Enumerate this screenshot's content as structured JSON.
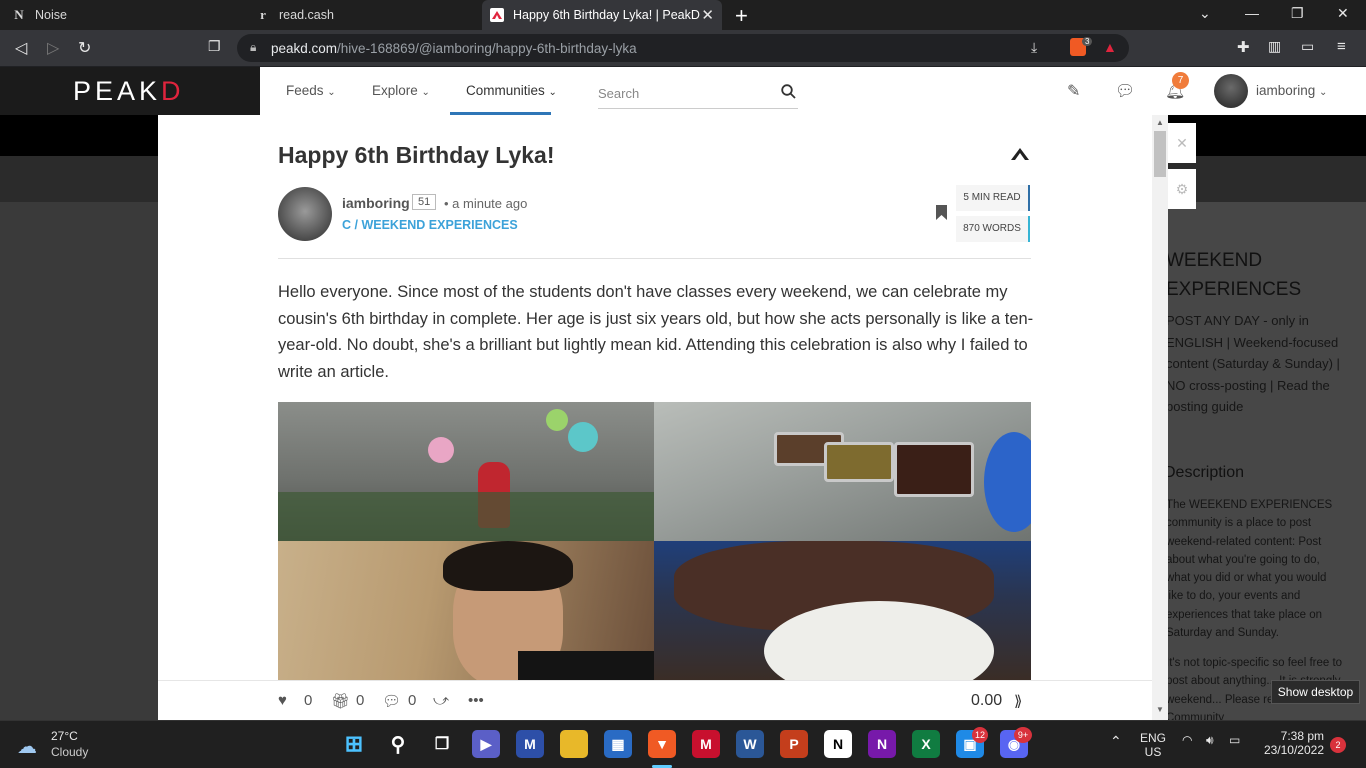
{
  "browser": {
    "tabs": [
      {
        "title": "Noise",
        "favicon": "N"
      },
      {
        "title": "read.cash",
        "favicon": "r"
      },
      {
        "title": "Happy 6th Birthday Lyka! | PeakD",
        "favicon": "peakd"
      }
    ],
    "new_tab": "+",
    "url_domain": "peakd.com",
    "url_path": "/hive-168869/@iamboring/happy-6th-birthday-lyka",
    "brave_badge": "3"
  },
  "header": {
    "logo_left": "PEA",
    "logo_mid": "K",
    "logo_right": "D",
    "menu": [
      "Feeds",
      "Explore",
      "Communities"
    ],
    "search_placeholder": "Search",
    "notifications": "7",
    "username": "iamboring"
  },
  "post": {
    "title": "Happy 6th Birthday Lyka!",
    "author": "iamboring",
    "reputation": "51",
    "time": "• a minute ago",
    "community": "C / WEEKEND EXPERIENCES",
    "read_time": "5 MIN READ",
    "words": "870 WORDS",
    "body": "Hello everyone. Since most of the students don't have classes every weekend, we can celebrate my cousin's 6th birthday in complete. Her age is just six years old, but how she acts personally is like a ten-year-old. No doubt, she's a brilliant but lightly mean kid. Attending this celebration is also why I failed to write an article.",
    "votes": "0",
    "reblogs": "0",
    "comments": "0",
    "payout": "0.00"
  },
  "sidebar": {
    "title": "WEEKEND EXPERIENCES",
    "about": "POST ANY DAY - only in ENGLISH | Weekend-focused content (Saturday & Sunday) | NO cross-posting | Read the posting guide",
    "description_heading": "Description",
    "description": "The WEEKEND EXPERIENCES community is a place to post weekend-related content: Post about what you're going to do, what you did or what you would like to do, your events and experiences that take place on Saturday and Sunday.",
    "description2": "It's not topic-specific so feel free to post about anything... It is strongly weekend... Please read the - Community"
  },
  "tooltip": "Show desktop",
  "taskbar": {
    "temp": "27°C",
    "condition": "Cloudy",
    "lang1": "ENG",
    "lang2": "US",
    "time": "7:38 pm",
    "date": "23/10/2022",
    "notif_count": "2",
    "office_badge": "12",
    "discord_badge": "9+"
  },
  "colors": {
    "accent": "#2f76b7",
    "community_link": "#3ca2d9",
    "logo_red": "#e0243d",
    "notif_badge": "#f07c3b"
  }
}
